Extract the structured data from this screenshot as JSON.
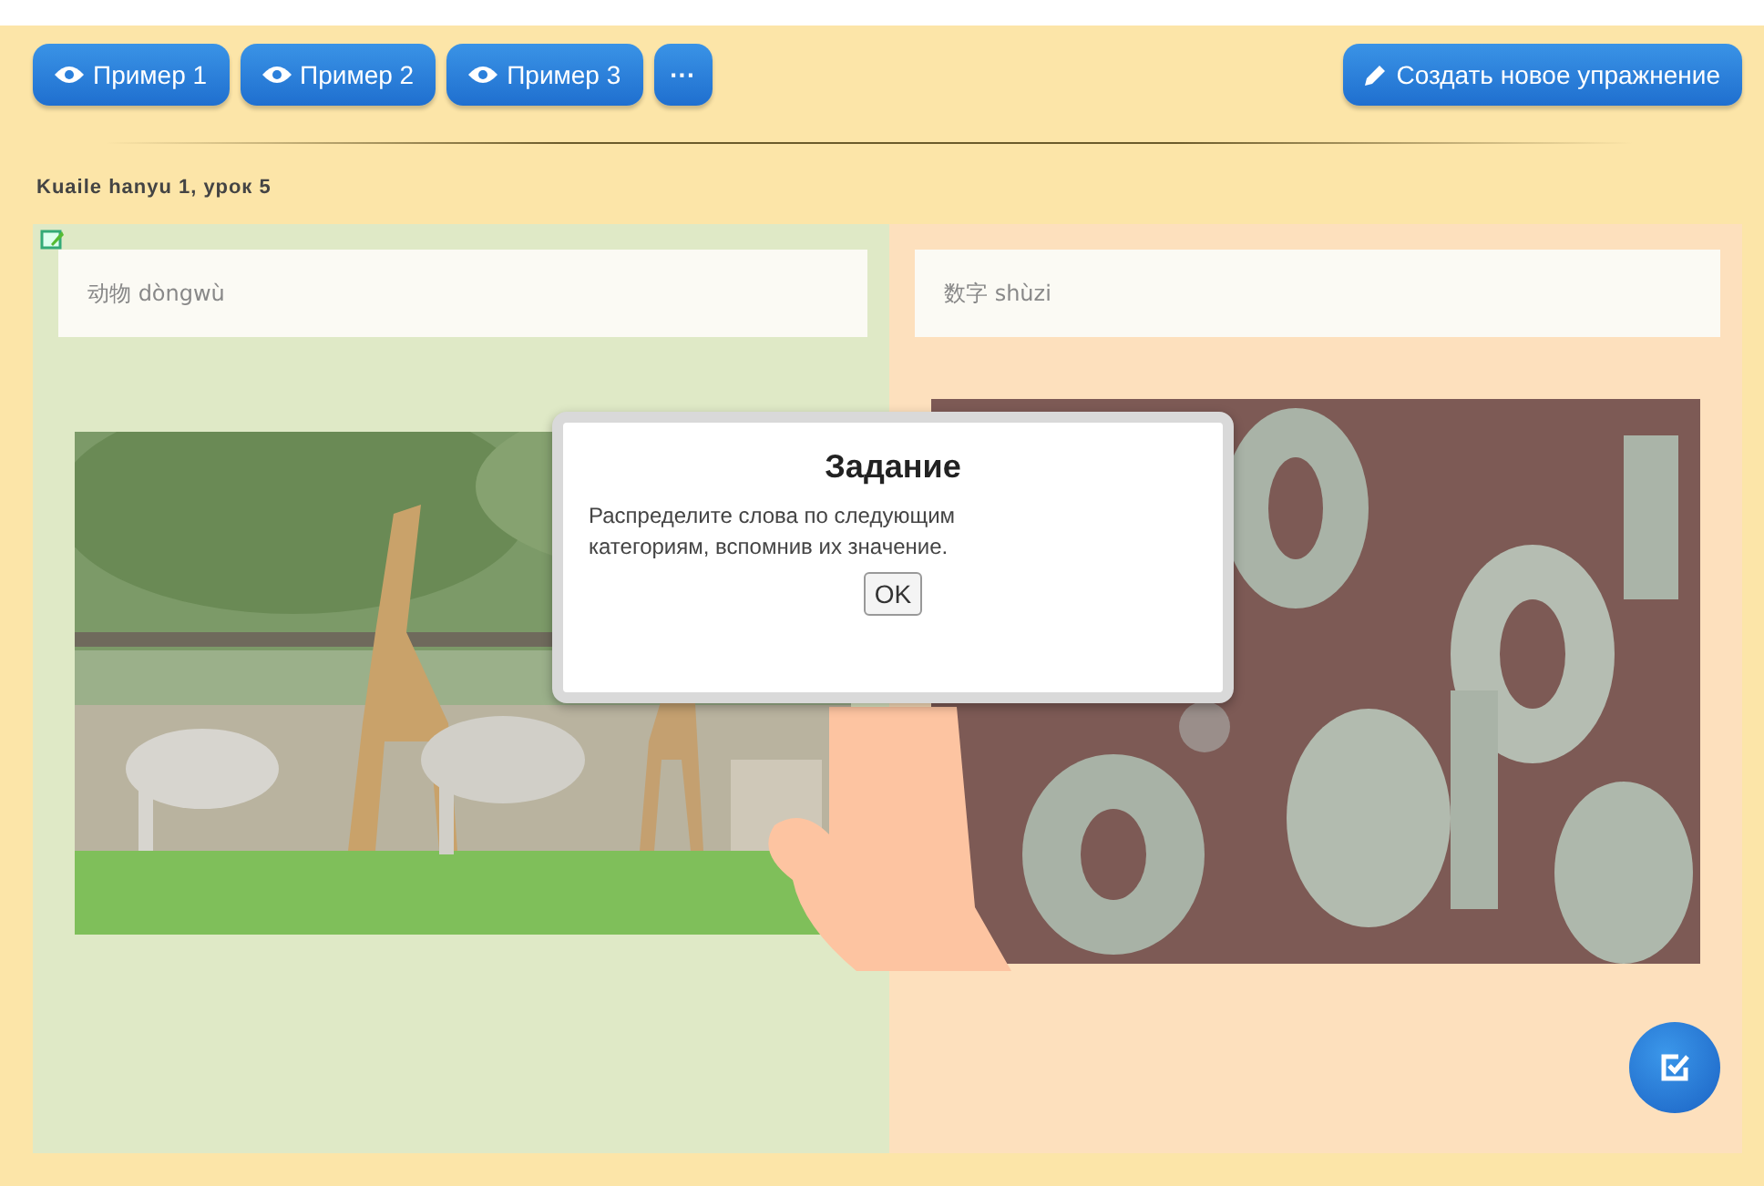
{
  "toolbar": {
    "examples": [
      {
        "label": "Пример 1"
      },
      {
        "label": "Пример 2"
      },
      {
        "label": "Пример 3"
      }
    ],
    "more": {
      "label": "···"
    },
    "create": {
      "label": "Создать новое упражнение"
    }
  },
  "lesson_title": "Kuaile hanyu 1, урок 5",
  "categories": [
    {
      "label": "动物 dòngwù",
      "kind": "animals"
    },
    {
      "label": "数字 shùzi",
      "kind": "numbers"
    }
  ],
  "dialog": {
    "title": "Задание",
    "message": "Распределите слова по следующим категориям, вспомнив их значение.",
    "button": "OK"
  }
}
